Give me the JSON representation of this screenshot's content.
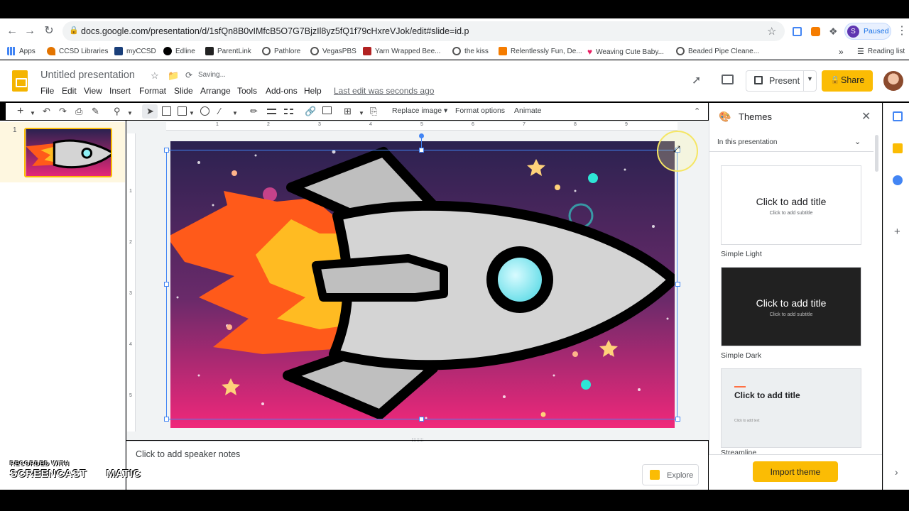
{
  "browser": {
    "url": "docs.google.com/presentation/d/1sfQn8B0vIMfcB5O7G7BjzIl8yz5fQ1f79cHxreVJok/edit#slide=id.p",
    "profile_initial": "S",
    "profile_status": "Paused"
  },
  "bookmarks": [
    {
      "label": "Apps",
      "color": "#4285f4"
    },
    {
      "label": "CCSD Libraries",
      "color": "#e37400"
    },
    {
      "label": "myCCSD",
      "color": "#1a3f7a"
    },
    {
      "label": "Edline",
      "color": "#000000"
    },
    {
      "label": "ParentLink",
      "color": "#222222"
    },
    {
      "label": "Pathlore",
      "color": "#555555"
    },
    {
      "label": "VegasPBS",
      "color": "#555555"
    },
    {
      "label": "Yarn Wrapped Bee...",
      "color": "#b22222"
    },
    {
      "label": "the kiss",
      "color": "#555555"
    },
    {
      "label": "Relentlessly Fun, De...",
      "color": "#f57c00"
    },
    {
      "label": "Weaving Cute Baby...",
      "color": "#e91e63"
    },
    {
      "label": "Beaded Pipe Cleane...",
      "color": "#555555"
    }
  ],
  "reading_list": "Reading list",
  "app": {
    "doc_title": "Untitled presentation",
    "saving": "Saving...",
    "menus": [
      "File",
      "Edit",
      "View",
      "Insert",
      "Format",
      "Slide",
      "Arrange",
      "Tools",
      "Add-ons",
      "Help"
    ],
    "last_edit": "Last edit was seconds ago",
    "present_label": "Present",
    "share_label": "Share"
  },
  "toolbar": {
    "replace_image": "Replace image",
    "format_options": "Format options",
    "animate": "Animate"
  },
  "filmstrip": {
    "slide_number": "1"
  },
  "ruler": {
    "top_numbers": [
      "1",
      "2",
      "3",
      "4",
      "5",
      "6",
      "7",
      "8",
      "9"
    ],
    "left_numbers": [
      "1",
      "2",
      "3",
      "4",
      "5"
    ]
  },
  "notes": {
    "placeholder": "Click to add speaker notes"
  },
  "explore_label": "Explore",
  "themes": {
    "title": "Themes",
    "dropdown": "In this presentation",
    "cards": [
      {
        "name": "Simple Light",
        "title": "Click to add title",
        "subtitle": "Click to add subtitle"
      },
      {
        "name": "Simple Dark",
        "title": "Click to add title",
        "subtitle": "Click to add subtitle"
      },
      {
        "name": "Streamline",
        "title": "Click to add title",
        "subtitle": "Click to add text"
      }
    ],
    "import_label": "Import theme"
  },
  "watermark": {
    "line1": "RECORDED WITH",
    "line2": "SCREENCAST",
    "line3": "MATIC"
  },
  "colors": {
    "accent": "#fbbc04",
    "selection": "#4285f4",
    "slide_top": "#2b2250",
    "slide_bottom": "#f0287a"
  }
}
